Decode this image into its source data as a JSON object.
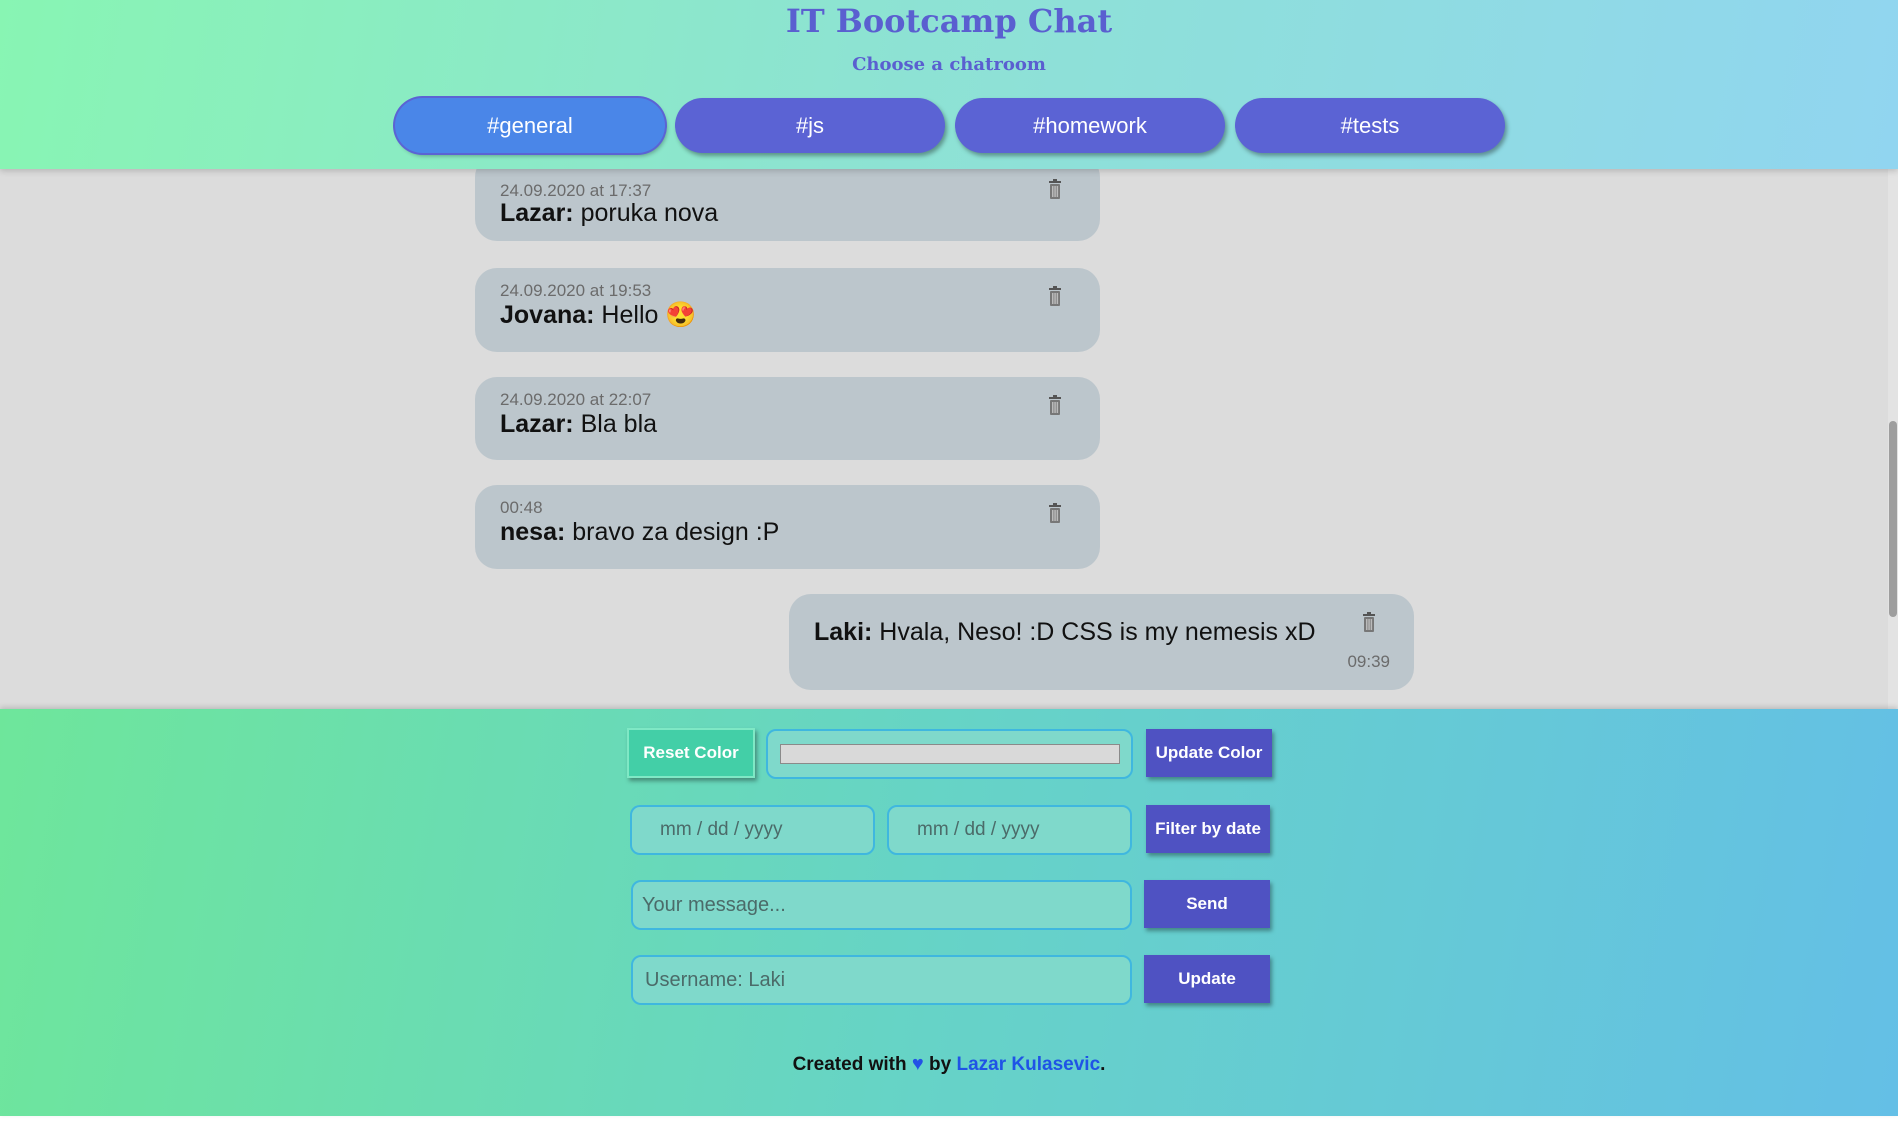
{
  "header": {
    "title": "IT Bootcamp Chat",
    "subtitle": "Choose a chatroom",
    "rooms": [
      {
        "label": "#general",
        "active": true
      },
      {
        "label": "#js",
        "active": false
      },
      {
        "label": "#homework",
        "active": false
      },
      {
        "label": "#tests",
        "active": false
      }
    ]
  },
  "messages": [
    {
      "time": "24.09.2020 at 17:37",
      "user": "Lazar:",
      "text": " poruka nova"
    },
    {
      "time": "24.09.2020 at 19:53",
      "user": "Jovana:",
      "text": " Hello 😍"
    },
    {
      "time": "24.09.2020 at 22:07",
      "user": "Lazar:",
      "text": " Bla bla"
    },
    {
      "time": "00:48",
      "user": "nesa:",
      "text": " bravo za design :P"
    },
    {
      "time": "09:39",
      "user": "Laki:",
      "text": " Hvala, Neso! :D CSS is my nemesis xD"
    }
  ],
  "controls": {
    "reset_color": "Reset Color",
    "update_color": "Update Color",
    "date_from_placeholder": "mm / dd / yyyy",
    "date_to_placeholder": "mm / dd / yyyy",
    "filter_by_date": "Filter by date",
    "message_placeholder": "Your message...",
    "send": "Send",
    "username_placeholder": "Username: Laki",
    "update": "Update"
  },
  "footer": {
    "prefix": "Created with",
    "heart": "♥",
    "by": "by",
    "author": "Lazar Kulasevic",
    "suffix": "."
  },
  "colors": {
    "accent": "#5b63d4",
    "active_room": "#4a86e8",
    "message_bg": "#bcc6cc",
    "chat_bg": "#dcdcdc"
  }
}
